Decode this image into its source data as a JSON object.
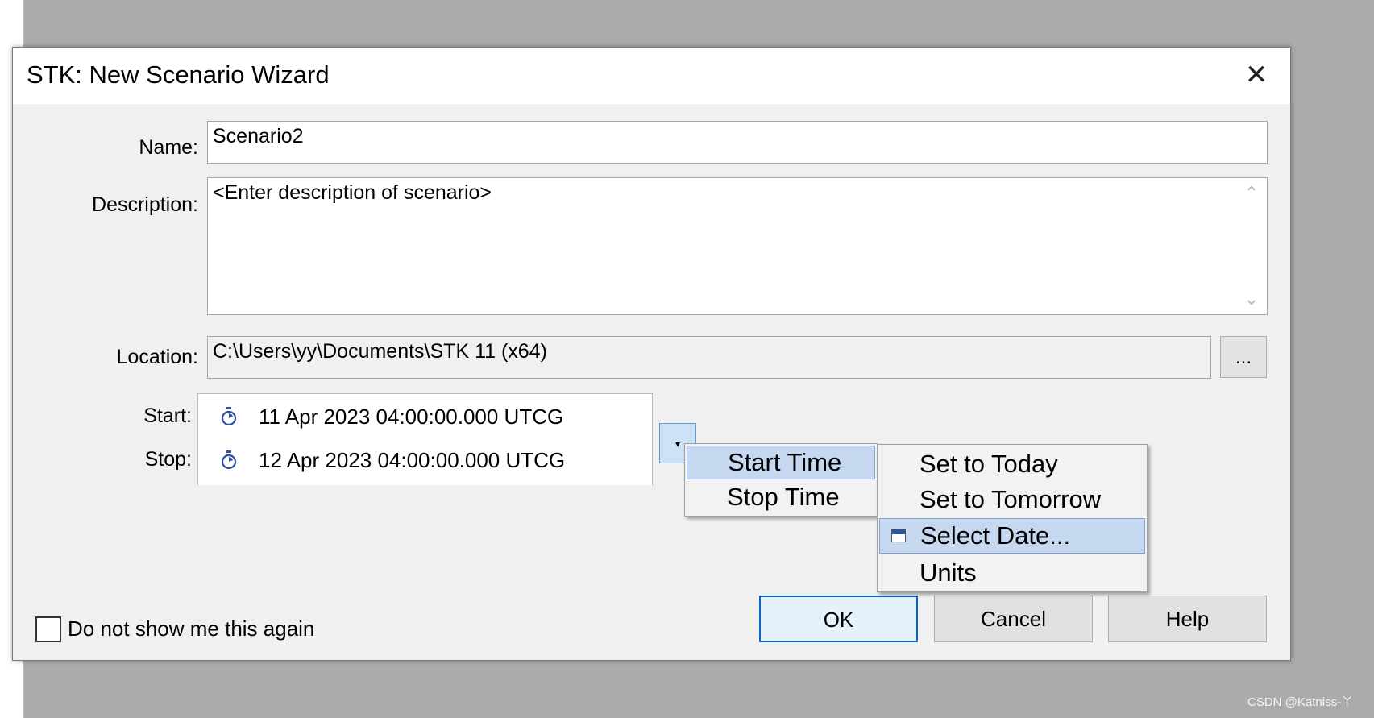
{
  "dialog": {
    "title": "STK: New Scenario Wizard",
    "close_label": "✕"
  },
  "form": {
    "name_label": "Name:",
    "name_value": "Scenario2",
    "description_label": "Description:",
    "description_value": "<Enter description of scenario>",
    "location_label": "Location:",
    "location_value": "C:\\Users\\yy\\Documents\\STK 11 (x64)",
    "browse_label": "...",
    "start_label": "Start:",
    "start_value": "11 Apr 2023 04:00:00.000 UTCG",
    "stop_label": "Stop:",
    "stop_value": "12 Apr 2023 04:00:00.000 UTCG",
    "dropdown_glyph": "▾"
  },
  "time_menu": {
    "items": [
      {
        "label": "Start Time",
        "highlighted": true
      },
      {
        "label": "Stop Time",
        "highlighted": false
      }
    ]
  },
  "sub_menu": {
    "items": [
      {
        "label": "Set to Today",
        "highlighted": false
      },
      {
        "label": "Set to Tomorrow",
        "highlighted": false
      },
      {
        "label": "Select Date...",
        "highlighted": true,
        "icon": "calendar-icon"
      },
      {
        "label": "Units",
        "highlighted": false
      }
    ]
  },
  "footer": {
    "checkbox_label": "Do not show me this again",
    "ok_label": "OK",
    "cancel_label": "Cancel",
    "help_label": "Help"
  },
  "watermark": "CSDN @Katniss-丫",
  "colors": {
    "highlight": "#c6d8f0",
    "default_button_border": "#0a64c8"
  }
}
